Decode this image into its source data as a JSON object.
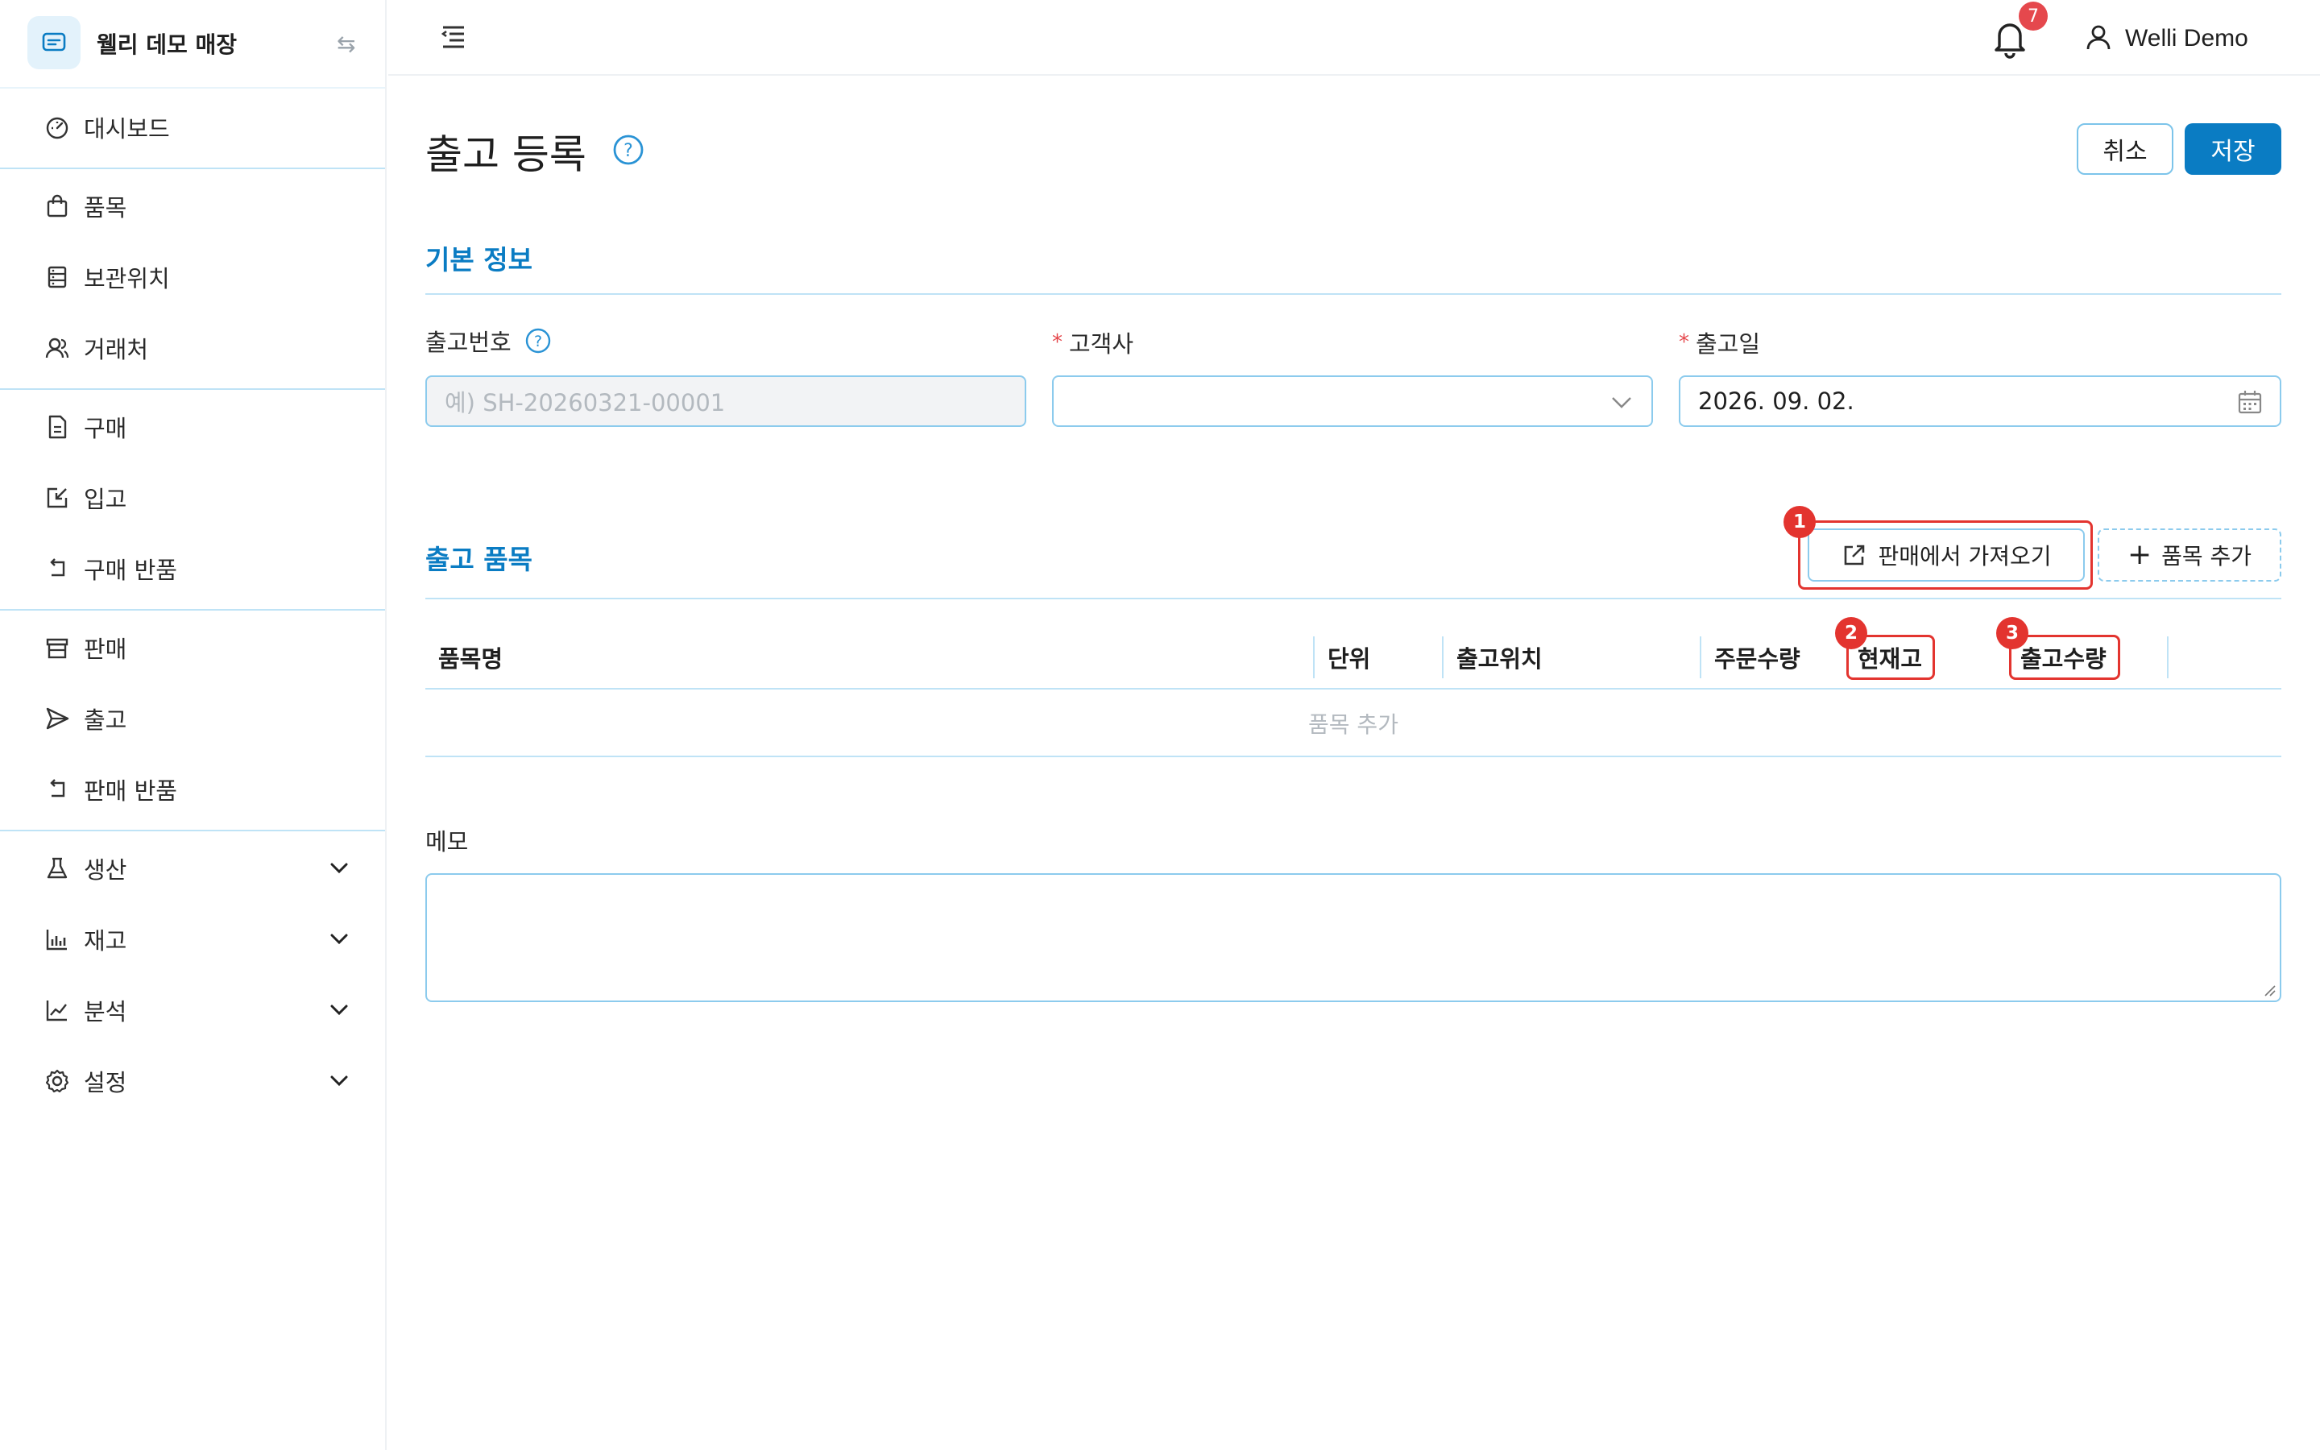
{
  "sidebar": {
    "store_name": "웰리 데모 매장",
    "switch_icon": "⇆",
    "items": [
      {
        "label": "대시보드",
        "icon": "dashboard-icon"
      },
      {
        "label": "품목",
        "icon": "bag-icon"
      },
      {
        "label": "보관위치",
        "icon": "storage-icon"
      },
      {
        "label": "거래처",
        "icon": "partner-icon"
      },
      {
        "label": "구매",
        "icon": "document-icon"
      },
      {
        "label": "입고",
        "icon": "inbound-icon"
      },
      {
        "label": "구매 반품",
        "icon": "return-icon"
      },
      {
        "label": "판매",
        "icon": "store-icon"
      },
      {
        "label": "출고",
        "icon": "send-icon"
      },
      {
        "label": "판매 반품",
        "icon": "return-icon"
      },
      {
        "label": "생산",
        "icon": "flask-icon"
      },
      {
        "label": "재고",
        "icon": "bar-chart-icon"
      },
      {
        "label": "분석",
        "icon": "line-chart-icon"
      },
      {
        "label": "설정",
        "icon": "gear-icon"
      }
    ]
  },
  "topbar": {
    "notification_count": "7",
    "user_name": "Welli Demo"
  },
  "page": {
    "title": "출고 등록",
    "cancel_label": "취소",
    "save_label": "저장"
  },
  "basic_info": {
    "section_title": "기본 정보",
    "shipment_no_label": "출고번호",
    "shipment_no_placeholder": "예) SH-20260321-00001",
    "customer_label": "고객사",
    "customer_value": "",
    "date_label": "출고일",
    "date_value": "2026. 09. 02.",
    "required_mark": "*"
  },
  "items": {
    "section_title": "출고 품목",
    "import_label": "판매에서 가져오기",
    "add_label": "품목 추가",
    "columns": [
      "품목명",
      "단위",
      "출고위치",
      "주문수량",
      "현재고",
      "출고수량"
    ],
    "empty_text": "품목 추가"
  },
  "annotations": [
    "1",
    "2",
    "3"
  ],
  "memo": {
    "label": "메모",
    "value": ""
  },
  "colors": {
    "accent": "#0a7cc3",
    "border": "#8ccbed",
    "annotation": "#e3342f",
    "badge": "#e5484d"
  }
}
